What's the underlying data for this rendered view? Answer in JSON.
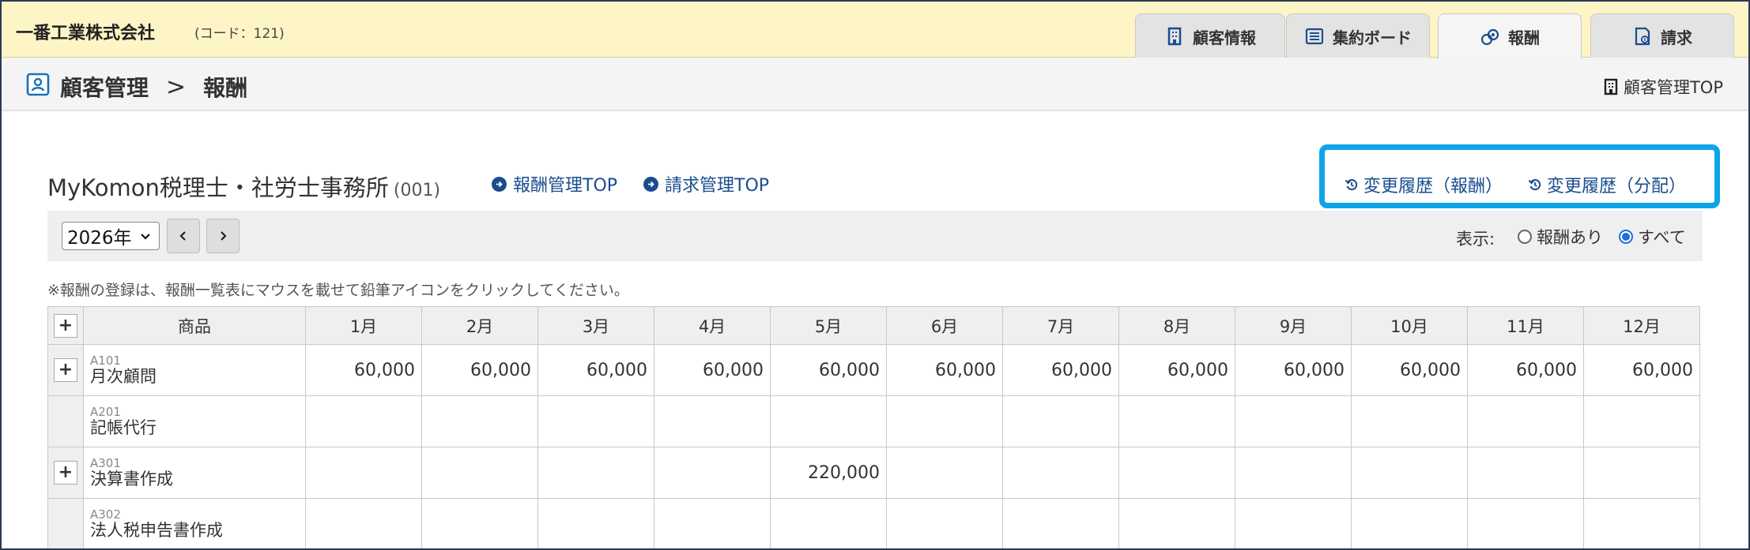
{
  "header": {
    "company_name": "一番工業株式会社",
    "company_code": "(コード：121)",
    "tabs": [
      {
        "label": "顧客情報",
        "icon": "building-icon",
        "active": false
      },
      {
        "label": "集約ボード",
        "icon": "list-board-icon",
        "active": false
      },
      {
        "label": "報酬",
        "icon": "fee-coins-icon",
        "active": true
      },
      {
        "label": "請求",
        "icon": "invoice-icon",
        "active": false
      }
    ]
  },
  "breadcrumb": {
    "icon": "person-card-icon",
    "root": "顧客管理",
    "separator": ">",
    "current": "報酬",
    "top_link_icon": "building-icon",
    "top_link": "顧客管理TOP"
  },
  "office": {
    "name": "MyKomon税理士・社労士事務所",
    "code": "(001)",
    "links": [
      "報酬管理TOP",
      "請求管理TOP"
    ]
  },
  "history": {
    "links": [
      "変更履歴（報酬）",
      "変更履歴（分配）"
    ],
    "highlight_color": "#0ea5e8"
  },
  "filter": {
    "year": "2026年",
    "prev_icon": "chevron-left-icon",
    "next_icon": "chevron-right-icon",
    "display_label": "表示:",
    "options": [
      {
        "label": "報酬あり",
        "selected": false
      },
      {
        "label": "すべて",
        "selected": true
      }
    ]
  },
  "notice": "※報酬の登録は、報酬一覧表にマウスを載せて鉛筆アイコンをクリックしてください。",
  "table": {
    "plus_symbol": "+",
    "product_header": "商品",
    "months": [
      "1月",
      "2月",
      "3月",
      "4月",
      "5月",
      "6月",
      "7月",
      "8月",
      "9月",
      "10月",
      "11月",
      "12月"
    ],
    "rows": [
      {
        "has_plus": true,
        "code": "A101",
        "name": "月次顧問",
        "values": [
          "60,000",
          "60,000",
          "60,000",
          "60,000",
          "60,000",
          "60,000",
          "60,000",
          "60,000",
          "60,000",
          "60,000",
          "60,000",
          "60,000"
        ]
      },
      {
        "has_plus": false,
        "code": "A201",
        "name": "記帳代行",
        "values": [
          "",
          "",
          "",
          "",
          "",
          "",
          "",
          "",
          "",
          "",
          "",
          ""
        ]
      },
      {
        "has_plus": true,
        "code": "A301",
        "name": "決算書作成",
        "values": [
          "",
          "",
          "",
          "",
          "220,000",
          "",
          "",
          "",
          "",
          "",
          "",
          ""
        ]
      },
      {
        "has_plus": false,
        "code": "A302",
        "name": "法人税申告書作成",
        "values": [
          "",
          "",
          "",
          "",
          "",
          "",
          "",
          "",
          "",
          "",
          "",
          ""
        ]
      }
    ]
  },
  "colors": {
    "header_bg": "#fdf5c6",
    "link": "#1a4d8f",
    "radio_on": "#1e6fd9"
  }
}
